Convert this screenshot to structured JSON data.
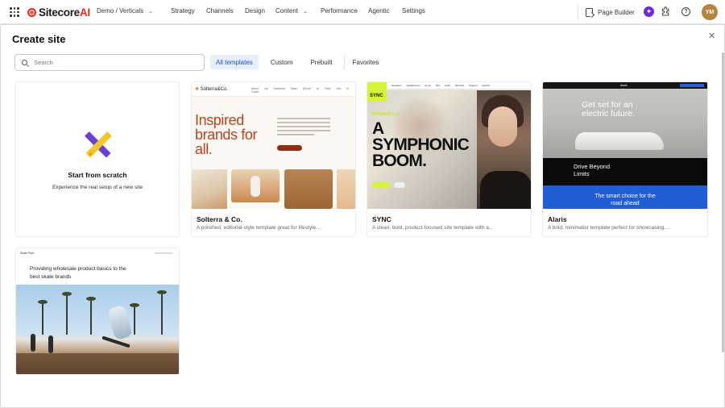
{
  "topbar": {
    "app_name_prefix": "Sitecore",
    "app_name_suffix": "AI",
    "site_switcher": "Demo / Verticals",
    "nav": [
      "Strategy",
      "Channels",
      "Design",
      "Content",
      "Performance",
      "Agentic",
      "Settings"
    ],
    "page_builder": "Page Builder",
    "avatar_initials": "YM"
  },
  "modal": {
    "title": "Create site",
    "search_placeholder": "Search",
    "tabs": [
      "All templates",
      "Custom",
      "Prebuilt",
      "Favorites"
    ],
    "active_tab": "All templates",
    "scratch": {
      "title": "Start from scratch",
      "description": "Experience the real setup of a new site"
    },
    "templates": [
      {
        "name": "Solterra & Co.",
        "description": "A polished, editorial-style template great for lifestyle...",
        "preview": {
          "brand": "Solterra&Co.",
          "links": "About Us Solutions Team [Scroll to Flex] Get in Touch",
          "headline": "Inspired brands for all."
        }
      },
      {
        "name": "SYNC",
        "description": "A clean, bold, product-focused site template with a...",
        "preview": {
          "badge": "SYNC",
          "nav": "Speakers Headphones Amps Pics Artist Services Support Search",
          "tag": "MONARCH II",
          "headline": "A SYMPHONIC BOOM."
        }
      },
      {
        "name": "Alaris",
        "description": "A bold, minimalist template perfect for showcasing...",
        "preview": {
          "nav": "Alaris",
          "headline": "Get set for an electric future.",
          "mid": "Drive Beyond Limits",
          "bottom": "The smart choice for the road ahead"
        }
      },
      {
        "name": "Skate Park",
        "description": "",
        "preview": {
          "brand": "Skate Park",
          "headline": "Providing wholesale product basics to the best skate brands"
        }
      }
    ]
  },
  "colors": {
    "brand_red": "#eb2c1f",
    "active_tab_bg": "#e6eefb",
    "active_tab_text": "#1b4fc2",
    "ai_purple": "#6d2bd9",
    "avatar": "#b3863f"
  }
}
